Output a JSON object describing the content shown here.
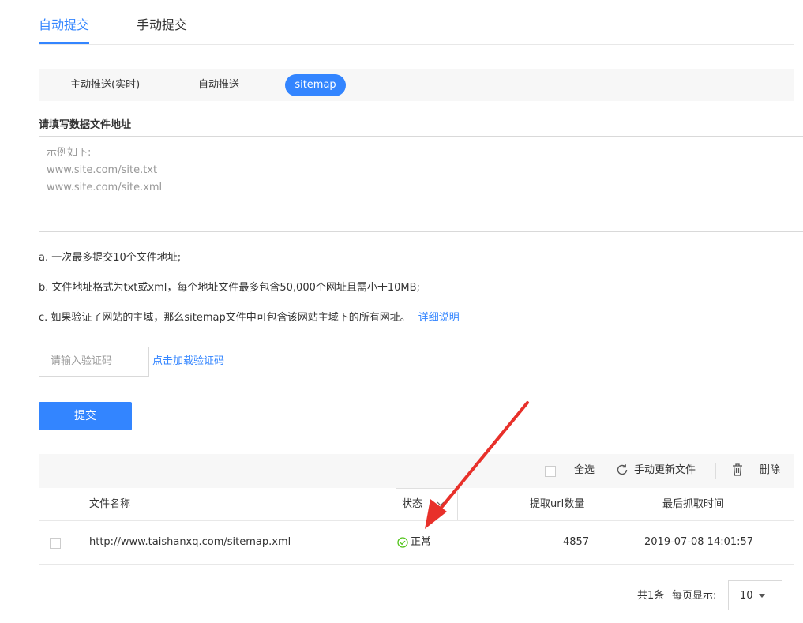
{
  "top_tabs": {
    "auto": "自动提交",
    "manual": "手动提交"
  },
  "sub_tabs": {
    "realtime": "主动推送(实时)",
    "auto_push": "自动推送",
    "sitemap": "sitemap"
  },
  "form": {
    "label": "请填写数据文件地址",
    "placeholder_lines": [
      "示例如下:",
      "www.site.com/site.txt",
      "www.site.com/site.xml"
    ],
    "notes": {
      "a": "a. 一次最多提交10个文件地址;",
      "b": "b. 文件地址格式为txt或xml，每个地址文件最多包含50,000个网址且需小于10MB;",
      "c": "c. 如果验证了网站的主域，那么sitemap文件中可包含该网站主域下的所有网址。",
      "detail_link": "详细说明"
    },
    "captcha_placeholder": "请输入验证码",
    "captcha_link": "点击加载验证码",
    "submit": "提交"
  },
  "toolbar": {
    "select_all": "全选",
    "refresh": "手动更新文件",
    "delete": "删除"
  },
  "table": {
    "headers": {
      "name": "文件名称",
      "status": "状态",
      "count": "提取url数量",
      "time": "最后抓取时间"
    },
    "rows": [
      {
        "url": "http://www.taishanxq.com/sitemap.xml",
        "status": "正常",
        "count": "4857",
        "time": "2019-07-08 14:01:57"
      }
    ]
  },
  "pager": {
    "total": "共1条",
    "per_page_label": "每页显示:",
    "per_page_value": "10"
  },
  "colors": {
    "accent": "#3385ff",
    "ok": "#52c41a",
    "annotation": "#e8302a"
  }
}
